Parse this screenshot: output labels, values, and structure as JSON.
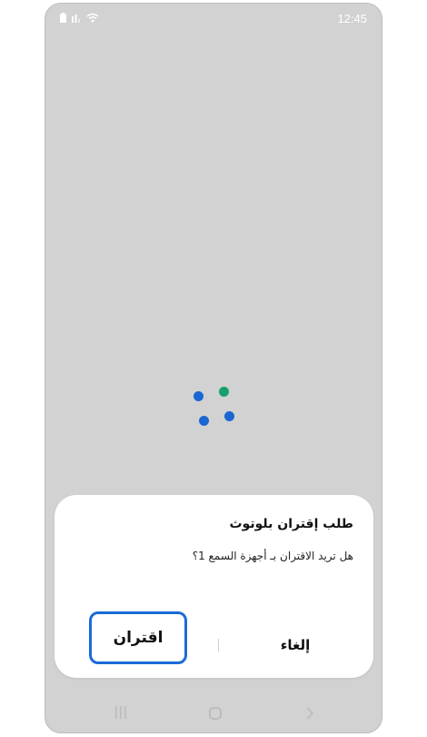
{
  "status_bar": {
    "time": "12:45",
    "icons": [
      "battery-icon",
      "signal-icon",
      "wifi-icon"
    ]
  },
  "loader": {
    "dot_colors": [
      "#1a66d2",
      "#17a06a",
      "#1a66d2",
      "#1a66d2"
    ]
  },
  "dialog": {
    "title": "طلب إقتران بلوتوث",
    "message": "هل تريد الاقتران بـ أجهزة السمع 1؟",
    "cancel_label": "إلغاء",
    "pair_label": "اقتران"
  },
  "nav_bar": {
    "icons": [
      "recents-icon",
      "home-icon",
      "back-icon"
    ]
  },
  "colors": {
    "backdrop": "#d2d2d2",
    "accent": "#1a6bd8"
  }
}
